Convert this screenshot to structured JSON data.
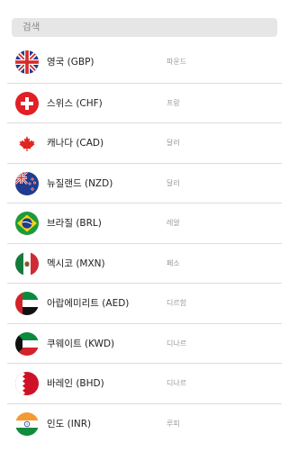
{
  "search": {
    "placeholder": "검색"
  },
  "currencies": [
    {
      "name": "영국 (GBP)",
      "unit": "파운드",
      "flag_icon": "uk-flag-icon"
    },
    {
      "name": "스위스 (CHF)",
      "unit": "프랑",
      "flag_icon": "switzerland-flag-icon"
    },
    {
      "name": "캐나다 (CAD)",
      "unit": "달러",
      "flag_icon": "canada-flag-icon"
    },
    {
      "name": "뉴질랜드 (NZD)",
      "unit": "달러",
      "flag_icon": "new-zealand-flag-icon"
    },
    {
      "name": "브라질 (BRL)",
      "unit": "레알",
      "flag_icon": "brazil-flag-icon"
    },
    {
      "name": "멕시코 (MXN)",
      "unit": "페소",
      "flag_icon": "mexico-flag-icon"
    },
    {
      "name": "아랍에미리트 (AED)",
      "unit": "디르함",
      "flag_icon": "uae-flag-icon"
    },
    {
      "name": "쿠웨이트 (KWD)",
      "unit": "디나르",
      "flag_icon": "kuwait-flag-icon"
    },
    {
      "name": "바레인 (BHD)",
      "unit": "디나르",
      "flag_icon": "bahrain-flag-icon"
    },
    {
      "name": "인도 (INR)",
      "unit": "루피",
      "flag_icon": "india-flag-icon"
    }
  ]
}
